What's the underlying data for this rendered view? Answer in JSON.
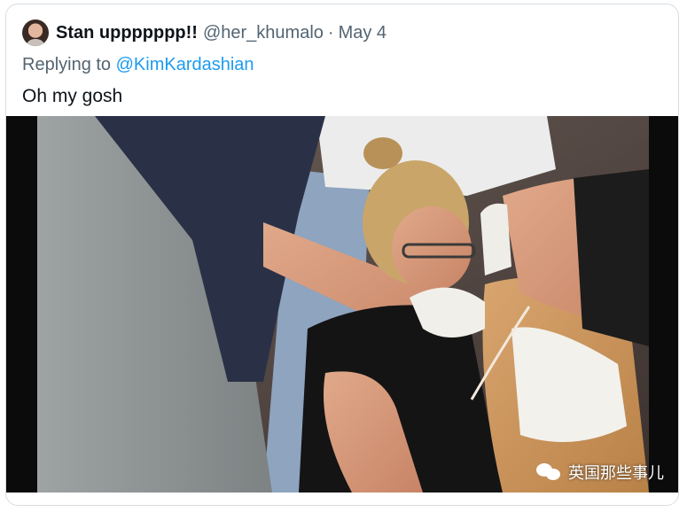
{
  "tweet": {
    "display_name": "Stan uppppppp!!",
    "handle": "@her_khumalo",
    "separator": "·",
    "date": "May 4",
    "replying_prefix": "Replying to",
    "replying_to": "@KimKardashian",
    "text": "Oh my gosh"
  },
  "media": {
    "watermark": "英国那些事儿"
  },
  "colors": {
    "name": "#0f1419",
    "secondary": "#536471",
    "link": "#1d9bf0",
    "border": "#d8dde2"
  },
  "icons": [
    "avatar",
    "wechat-icon"
  ]
}
